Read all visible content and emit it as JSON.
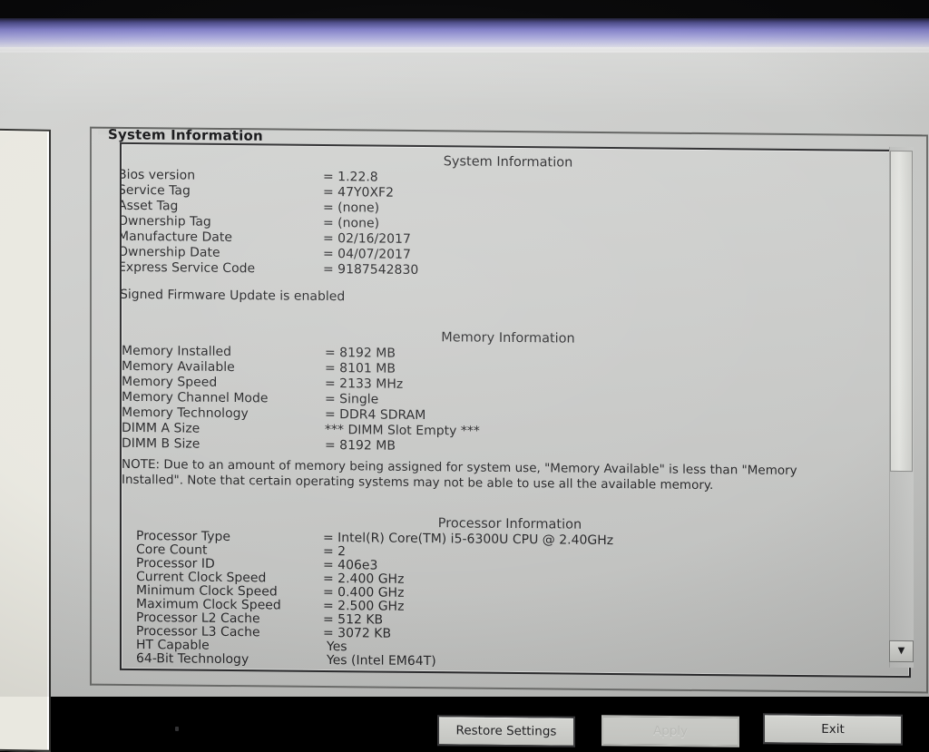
{
  "window": {
    "group_box_legend": "System Information"
  },
  "sections": [
    {
      "id": "system-information",
      "heading": "System Information",
      "rows": [
        {
          "label": "Bios version",
          "value": "= 1.22.8"
        },
        {
          "label": "Service Tag",
          "value": "= 47Y0XF2"
        },
        {
          "label": "Asset Tag",
          "value": "= (none)"
        },
        {
          "label": "Ownership Tag",
          "value": "= (none)"
        },
        {
          "label": "Manufacture Date",
          "value": "= 02/16/2017"
        },
        {
          "label": "Ownership Date",
          "value": "= 04/07/2017"
        },
        {
          "label": "Express Service Code",
          "value": "= 9187542830"
        }
      ],
      "standalone_note": "Signed Firmware Update is enabled"
    },
    {
      "id": "memory-information",
      "heading": "Memory Information",
      "rows": [
        {
          "label": "Memory Installed",
          "value": "= 8192 MB"
        },
        {
          "label": "Memory Available",
          "value": "= 8101 MB"
        },
        {
          "label": "Memory Speed",
          "value": "= 2133 MHz"
        },
        {
          "label": "Memory Channel Mode",
          "value": "= Single"
        },
        {
          "label": "Memory Technology",
          "value": "= DDR4 SDRAM"
        },
        {
          "label": "DIMM A Size",
          "value": "*** DIMM Slot Empty ***"
        },
        {
          "label": "DIMM B Size",
          "value": "= 8192 MB"
        }
      ],
      "note": "NOTE: Due to an amount of memory being assigned for system use, \"Memory Available\" is less than \"Memory Installed\". Note that certain operating systems may not be able to use all the available memory."
    },
    {
      "id": "processor-information",
      "heading": "Processor Information",
      "rows": [
        {
          "label": "Processor Type",
          "value": "= Intel(R) Core(TM) i5-6300U CPU @ 2.40GHz"
        },
        {
          "label": "Core Count",
          "value": "= 2"
        },
        {
          "label": "Processor ID",
          "value": "= 406e3"
        },
        {
          "label": "Current Clock Speed",
          "value": "= 2.400 GHz"
        },
        {
          "label": "Minimum Clock Speed",
          "value": "= 0.400 GHz"
        },
        {
          "label": "Maximum Clock Speed",
          "value": "= 2.500 GHz"
        },
        {
          "label": "Processor L2 Cache",
          "value": "= 512 KB"
        },
        {
          "label": "Processor L3 Cache",
          "value": "= 3072 KB"
        },
        {
          "label": "HT Capable",
          "value": "Yes"
        },
        {
          "label": "64-Bit Technology",
          "value": "Yes (Intel EM64T)"
        }
      ]
    }
  ],
  "scrollbar": {
    "down_arrow_glyph": "▼"
  },
  "buttons": {
    "restore": "Restore Settings",
    "apply": "Apply",
    "exit": "Exit"
  },
  "colors": {
    "titlebar_accent": "#7e7cc4",
    "panel_bg": "#c9cac8",
    "content_bg": "#c6c7c5",
    "text": "#232325",
    "disabled_text": "#b9bab6"
  }
}
